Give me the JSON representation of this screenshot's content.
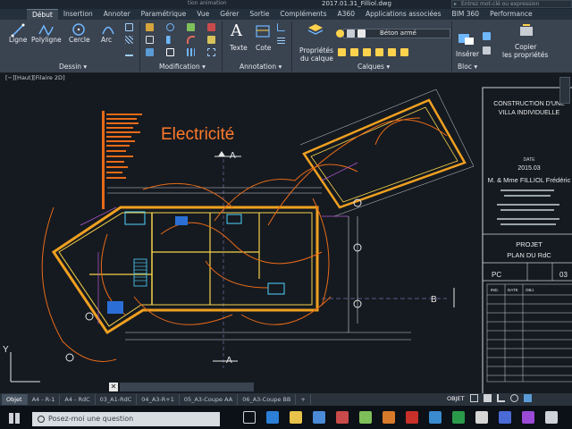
{
  "window": {
    "file_title": "2017.01.31_Filliol.dwg",
    "title_fragment": "tion animation",
    "search_placeholder": "Entrez mot-clé ou expression"
  },
  "ribbon_tabs": [
    {
      "label": "Début",
      "active": true
    },
    {
      "label": "Insertion",
      "active": false
    },
    {
      "label": "Annoter",
      "active": false
    },
    {
      "label": "Paramétrique",
      "active": false
    },
    {
      "label": "Vue",
      "active": false
    },
    {
      "label": "Gérer",
      "active": false
    },
    {
      "label": "Sortie",
      "active": false
    },
    {
      "label": "Compléments",
      "active": false
    },
    {
      "label": "A360",
      "active": false
    },
    {
      "label": "Applications associées",
      "active": false
    },
    {
      "label": "BIM 360",
      "active": false
    },
    {
      "label": "Performance",
      "active": false
    }
  ],
  "ribbon": {
    "ligne": "Ligne",
    "polyligne": "Polyligne",
    "cercle": "Cercle",
    "arc": "Arc",
    "texte": "Texte",
    "cote": "Cote",
    "proprietes_calque_1": "Propriétés",
    "proprietes_calque_2": "du calque",
    "layer_name": "Béton armé",
    "inserer": "Insérer",
    "copier_1": "Copier",
    "copier_2": "les propriétés",
    "panels": {
      "dessin": "Dessin ▾",
      "modification": "Modification ▾",
      "annotation": "Annotation ▾",
      "calques": "Calques ▾",
      "bloc": "Bloc ▾"
    }
  },
  "viewport": {
    "label": "[−][Haut][Filaire 2D]"
  },
  "drawing": {
    "title": "Electricité",
    "section_a_top": "A",
    "section_a_bottom": "A",
    "section_b": "B",
    "axis_y": "Y",
    "cartouche": {
      "line1": "CONSTRUCTION D'UNE",
      "line2": "VILLA INDIVIDUELLE",
      "date_label": "DATE",
      "date": "2015.03",
      "client": "M. & Mme FILLIOL Frédéric",
      "projet": "PROJET",
      "plan": "PLAN DU RdC",
      "phase": "PC",
      "planche": "03",
      "table_headers": [
        "IND.",
        "DATE",
        "OBJ."
      ]
    }
  },
  "layout_tabs": [
    {
      "label": "Objet",
      "active": true
    },
    {
      "label": "A4 - R-1",
      "active": false
    },
    {
      "label": "A4 - RdC",
      "active": false
    },
    {
      "label": "03_A1-RdC",
      "active": false
    },
    {
      "label": "04_A3-R+1",
      "active": false
    },
    {
      "label": "05_A3-Coupe AA",
      "active": false
    },
    {
      "label": "06_A3-Coupe BB",
      "active": false
    },
    {
      "label": "+",
      "active": false
    }
  ],
  "status": {
    "mode": "OBJET"
  },
  "taskbar": {
    "search_placeholder": "Posez-moi une question"
  }
}
